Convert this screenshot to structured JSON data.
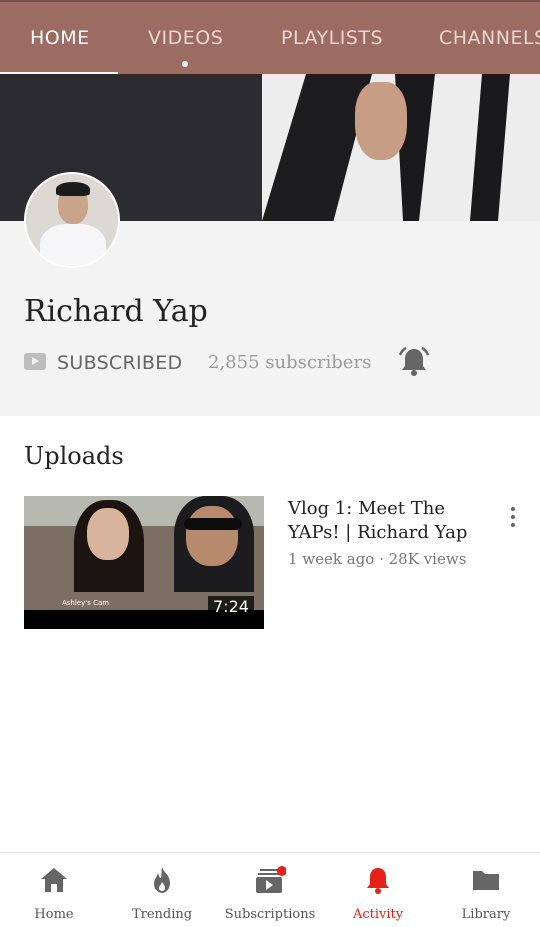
{
  "tabs": [
    {
      "label": "HOME",
      "active": true
    },
    {
      "label": "VIDEOS",
      "active": false
    },
    {
      "label": "PLAYLISTS",
      "active": false
    },
    {
      "label": "CHANNELS",
      "active": false
    }
  ],
  "channel": {
    "name": "Richard Yap",
    "subscribe_label": "SUBSCRIBED",
    "subscribers": "2,855 subscribers"
  },
  "uploads": {
    "heading": "Uploads",
    "videos": [
      {
        "title": "Vlog 1: Meet The YAPs! | Richard Yap",
        "meta": "1 week ago · 28K views",
        "duration": "7:24",
        "thumbnail_caption": "Ashley's Cam"
      }
    ]
  },
  "bottom_nav": [
    {
      "label": "Home",
      "icon": "home-icon"
    },
    {
      "label": "Trending",
      "icon": "trending-icon"
    },
    {
      "label": "Subscriptions",
      "icon": "subscriptions-icon"
    },
    {
      "label": "Activity",
      "icon": "bell-icon"
    },
    {
      "label": "Library",
      "icon": "folder-icon"
    }
  ],
  "colors": {
    "header": "#9c6b61",
    "accent": "#e62117",
    "icon_gray": "#666666"
  }
}
